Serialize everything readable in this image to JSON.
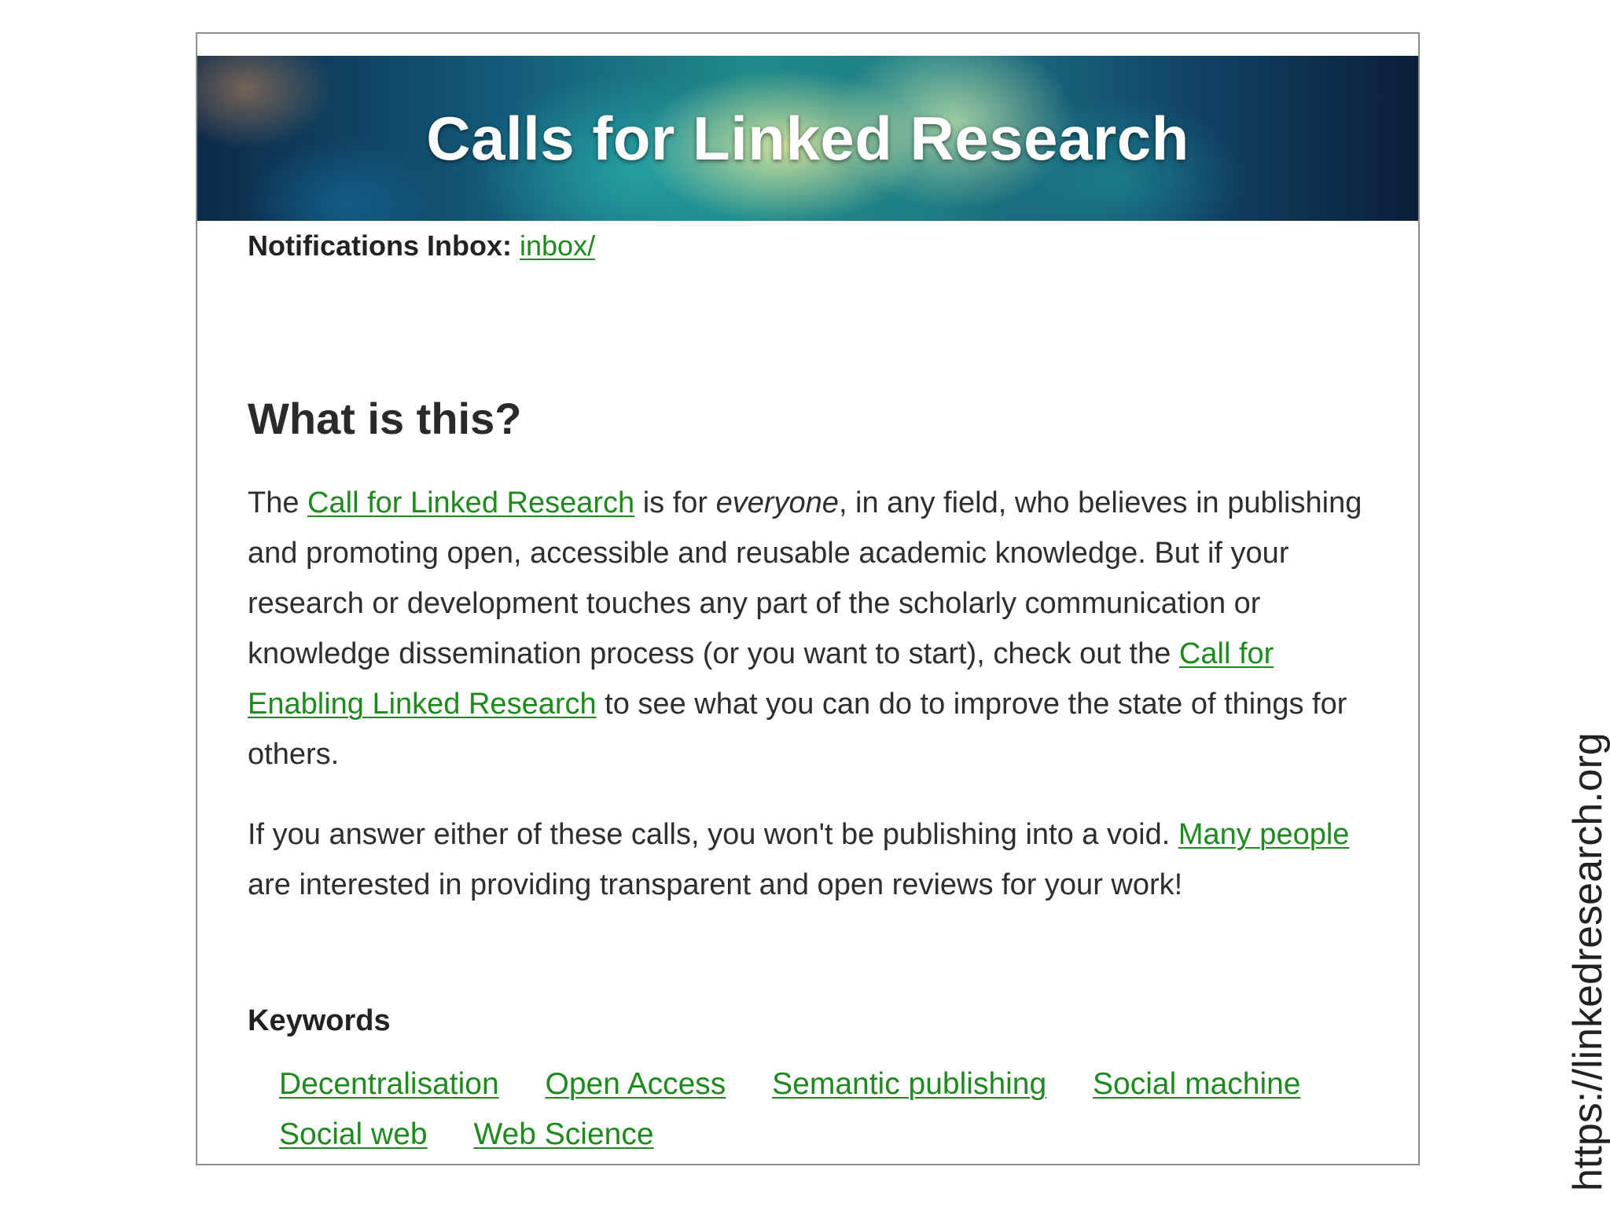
{
  "banner": {
    "title": "Calls for Linked Research"
  },
  "inbox": {
    "label": "Notifications Inbox:",
    "link": "inbox/"
  },
  "section": {
    "title": "What is this?"
  },
  "paragraph1": {
    "t1": "The ",
    "link1": "Call for Linked Research",
    "t2": " is for ",
    "em": "everyone",
    "t3": ", in any field, who believes in publishing and promoting open, accessible and reusable academic knowledge. But if your research or development touches any part of the scholarly communication or knowledge dissemination process (or you want to start), check out the ",
    "link2": "Call for Enabling Linked Research",
    "t4": " to see what you can do to improve the state of things for others."
  },
  "paragraph2": {
    "t1": "If you answer either of these calls, you won't be publishing into a void. ",
    "link": "Many people",
    "t2": " are interested in providing transparent and open reviews for your work!"
  },
  "keywords": {
    "title": "Keywords",
    "items": [
      "Decentralisation",
      "Open Access",
      "Semantic publishing",
      "Social machine",
      "Social web",
      "Web Science"
    ]
  },
  "side_url": "https://linkedresearch.org",
  "colors": {
    "link": "#1e8a1e",
    "text": "#2e2e2e",
    "border": "#8e8e8e"
  }
}
